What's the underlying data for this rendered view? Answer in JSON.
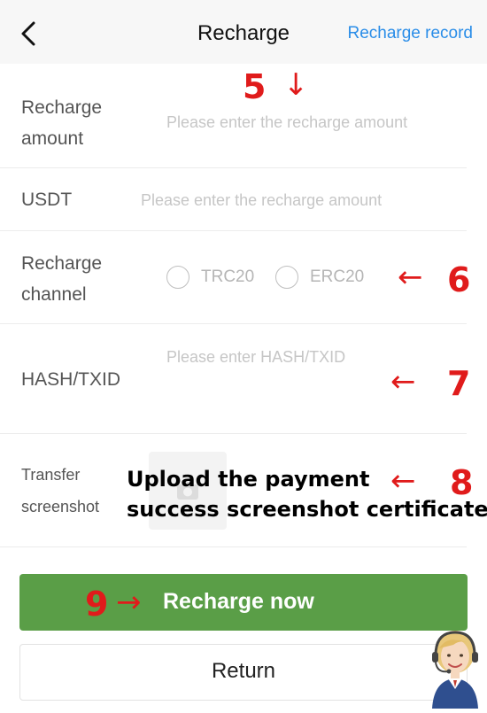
{
  "header": {
    "title": "Recharge",
    "record_link": "Recharge record"
  },
  "form": {
    "amount": {
      "label_line1": "Recharge",
      "label_line2": "amount",
      "placeholder": "Please enter the recharge amount"
    },
    "usdt": {
      "label": "USDT",
      "placeholder": "Please enter the recharge amount"
    },
    "channel": {
      "label_line1": "Recharge",
      "label_line2": "channel",
      "options": [
        "TRC20",
        "ERC20"
      ]
    },
    "hash": {
      "label": "HASH/TXID",
      "placeholder": "Please enter HASH/TXID"
    },
    "screenshot": {
      "label_line1": "Transfer",
      "label_line2": "screenshot"
    }
  },
  "annotations": {
    "step5": {
      "number": "5",
      "arrow": "↓"
    },
    "step6": {
      "number": "6",
      "arrow": "←"
    },
    "step7": {
      "number": "7",
      "arrow": "←"
    },
    "step8": {
      "number": "8",
      "arrow": "←",
      "text_line1": "Upload the payment",
      "text_line2": "success screenshot certificate"
    },
    "step9": {
      "number": "9",
      "arrow": "→"
    }
  },
  "buttons": {
    "recharge": "Recharge now",
    "return": "Return"
  },
  "icons": {
    "back": "chevron-left-icon",
    "upload": "camera-icon",
    "avatar": "customer-service-agent-icon"
  },
  "colors": {
    "link": "#2a8de8",
    "primary_button": "#5a9e47",
    "annotation": "#e01b1b"
  }
}
